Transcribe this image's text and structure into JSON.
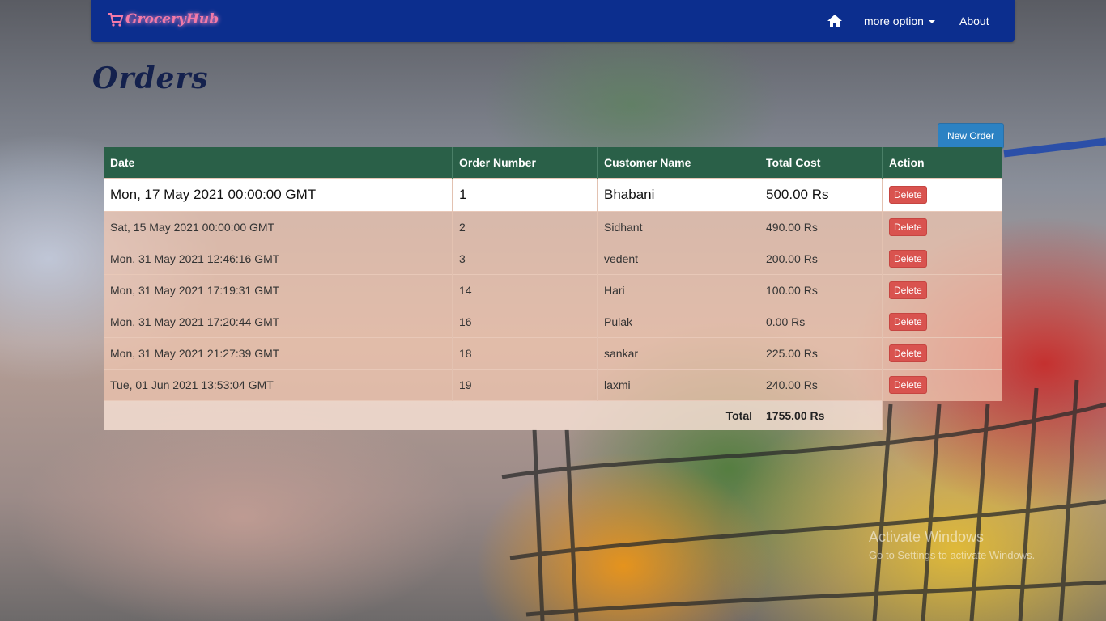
{
  "navbar": {
    "brand": "GroceryHub",
    "home_icon": "home-icon",
    "more_label": "more option",
    "about_label": "About"
  },
  "page": {
    "title": "Orders"
  },
  "actions": {
    "new_order": "New Order"
  },
  "table": {
    "headers": [
      "Date",
      "Order Number",
      "Customer Name",
      "Total Cost",
      "Action"
    ],
    "rows": [
      {
        "date": "Mon, 17 May 2021 00:00:00 GMT",
        "number": "1",
        "customer": "Bhabani",
        "cost": "500.00 Rs",
        "action": "Delete"
      },
      {
        "date": "Sat, 15 May 2021 00:00:00 GMT",
        "number": "2",
        "customer": "Sidhant",
        "cost": "490.00 Rs",
        "action": "Delete"
      },
      {
        "date": "Mon, 31 May 2021 12:46:16 GMT",
        "number": "3",
        "customer": "vedent",
        "cost": "200.00 Rs",
        "action": "Delete"
      },
      {
        "date": "Mon, 31 May 2021 17:19:31 GMT",
        "number": "14",
        "customer": "Hari",
        "cost": "100.00 Rs",
        "action": "Delete"
      },
      {
        "date": "Mon, 31 May 2021 17:20:44 GMT",
        "number": "16",
        "customer": "Pulak",
        "cost": "0.00 Rs",
        "action": "Delete"
      },
      {
        "date": "Mon, 31 May 2021 21:27:39 GMT",
        "number": "18",
        "customer": "sankar",
        "cost": "225.00 Rs",
        "action": "Delete"
      },
      {
        "date": "Tue, 01 Jun 2021 13:53:04 GMT",
        "number": "19",
        "customer": "laxmi",
        "cost": "240.00 Rs",
        "action": "Delete"
      }
    ],
    "total_label": "Total",
    "total_value": "1755.00 Rs"
  },
  "watermark": {
    "line1": "Activate Windows",
    "line2": "Go to Settings to activate Windows."
  },
  "colors": {
    "navbar": "#0c2e8e",
    "table_header": "#2a6048",
    "delete_button": "#d9534f",
    "new_order_button": "#2c82c3",
    "brand": "#f27aa8"
  }
}
